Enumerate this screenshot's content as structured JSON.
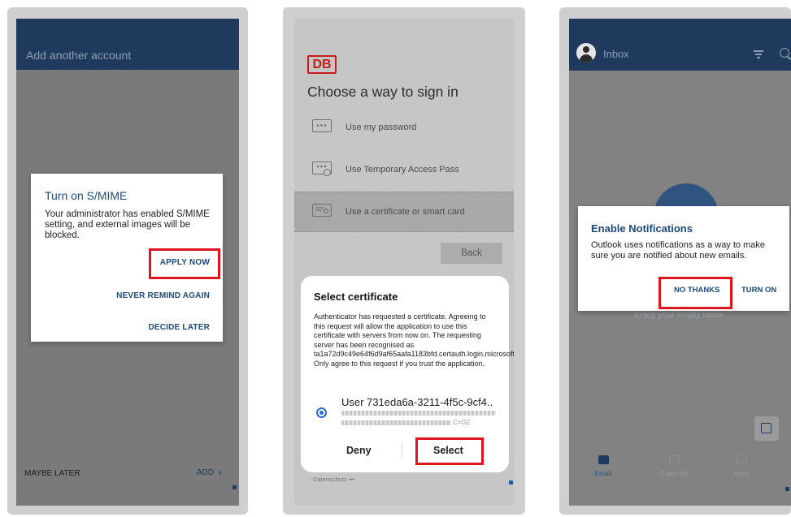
{
  "phone1": {
    "header_title": "Add another account",
    "dialog": {
      "title": "Turn on S/MIME",
      "body": "Your administrator has enabled S/MIME setting, and external images will be blocked.",
      "apply": "APPLY NOW",
      "never": "NEVER REMIND AGAIN",
      "later": "DECIDE LATER"
    },
    "footer": {
      "maybe_later": "MAYBE LATER",
      "add": "ADD",
      "add_chevron": "›"
    }
  },
  "phone2": {
    "logo": "DB",
    "heading": "Choose a way to sign in",
    "options": [
      {
        "label": "Use my password",
        "icon": "password-icon"
      },
      {
        "label": "Use Temporary Access Pass",
        "icon": "temporary-pass-icon"
      },
      {
        "label": "Use a certificate or smart card",
        "icon": "certificate-icon",
        "selected": true
      }
    ],
    "back": "Back",
    "dialog": {
      "title": "Select certificate",
      "body": "Authenticator has requested a certificate. Agreeing to this request will allow the application to use this certificate with servers from now on. The requesting server has been recognised as ta1a72d9c49e64f6d9af65aafa1183bfd.certauth.login.microsoftonline.com:443. Only agree to this request if you trust the application.",
      "certificate_name": "User 731eda6a-3211-4f5c-9cf4..",
      "certificate_suffix": "C=G2",
      "deny": "Deny",
      "select": "Select"
    },
    "footer_text": "Datenschutz  •••"
  },
  "phone3": {
    "header_title": "Inbox",
    "empty_text": "Enjoy your empty inbox.",
    "dialog": {
      "title": "Enable Notifications",
      "body": "Outlook uses notifications as a way to make sure you are notified about new emails.",
      "no_thanks": "NO THANKS",
      "turn_on": "TURN ON"
    },
    "tabs": [
      {
        "label": "Email",
        "active": true
      },
      {
        "label": "Calendar",
        "active": false
      },
      {
        "label": "Apps",
        "active": false
      }
    ]
  },
  "colors": {
    "highlight": "#e0141e",
    "outlook_blue": "#1f3a5c",
    "db_red": "#c51b1b",
    "radio_blue": "#2e6bd6"
  }
}
